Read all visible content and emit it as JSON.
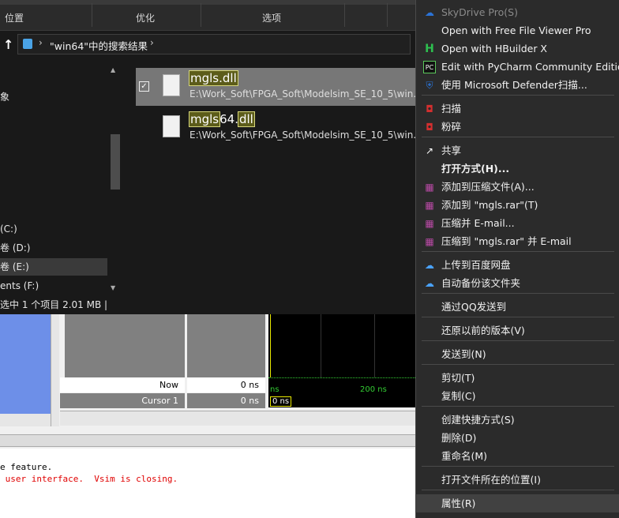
{
  "explorer": {
    "ribbon": {
      "group1": "位置",
      "group2": "优化",
      "group3": "选项"
    },
    "address": {
      "path": "\"win64\"中的搜索结果",
      "chevron": "›"
    },
    "nav": [
      {
        "label": "象"
      },
      {
        "label": "(C:)"
      },
      {
        "label": "卷 (D:)"
      },
      {
        "label": "卷 (E:)"
      },
      {
        "label": "ents (F:)"
      }
    ],
    "results": [
      {
        "name_hl1": "mgls.dll",
        "name_rest": "",
        "name_hl2": "",
        "path": "E:\\Work_Soft\\FPGA_Soft\\Modelsim_SE_10_5\\win...",
        "selected": true
      },
      {
        "name_hl1": "mgls",
        "name_rest": "64.",
        "name_hl2": "dll",
        "path": "E:\\Work_Soft\\FPGA_Soft\\Modelsim_SE_10_5\\win...",
        "selected": false
      }
    ],
    "status": "选中 1 个项目  2.01 MB  |"
  },
  "modelsim": {
    "now_label": "Now",
    "now_value": "0 ns",
    "cursor_label": "Cursor 1",
    "cursor_value": "0 ns",
    "wave_tick1": "ns",
    "wave_tick2": "200 ns",
    "wave_cursor": "0 ns",
    "console_line1": "e feature.",
    "console_line2": " user interface.  Vsim is closing."
  },
  "menu": {
    "items": [
      {
        "label": "SkyDrive Pro(S)",
        "icon": "☁",
        "icon_color": "#2b73d6",
        "disabled": true
      },
      {
        "label": "Open with Free File Viewer Pro",
        "icon": "",
        "icon_color": ""
      },
      {
        "label": "Open with HBuilder X",
        "icon": "H",
        "icon_color": "#2dbf4f"
      },
      {
        "label": "Edit with PyCharm Community Edition",
        "icon": "PC",
        "icon_color": "#000000"
      },
      {
        "label": "使用 Microsoft Defender扫描...",
        "icon": "⛨",
        "icon_color": "#2b73d6"
      },
      {
        "label": "扫描",
        "icon": "◘",
        "icon_color": "#d32f2f"
      },
      {
        "label": "粉碎",
        "icon": "◘",
        "icon_color": "#d32f2f"
      },
      {
        "label": "共享",
        "icon": "↗",
        "icon_color": "#ffffff"
      },
      {
        "label": "打开方式(H)...",
        "icon": "",
        "icon_color": ""
      },
      {
        "label": "添加到压缩文件(A)...",
        "icon": "▦",
        "icon_color": "#b94aa5"
      },
      {
        "label": "添加到 \"mgls.rar\"(T)",
        "icon": "▦",
        "icon_color": "#b94aa5"
      },
      {
        "label": "压缩并 E-mail...",
        "icon": "▦",
        "icon_color": "#b94aa5"
      },
      {
        "label": "压缩到 \"mgls.rar\" 并 E-mail",
        "icon": "▦",
        "icon_color": "#b94aa5"
      },
      {
        "label": "上传到百度网盘",
        "icon": "☁",
        "icon_color": "#4aa3ff"
      },
      {
        "label": "自动备份该文件夹",
        "icon": "☁",
        "icon_color": "#4aa3ff"
      },
      {
        "label": "通过QQ发送到",
        "icon": "",
        "icon_color": ""
      },
      {
        "label": "还原以前的版本(V)",
        "icon": "",
        "icon_color": ""
      },
      {
        "label": "发送到(N)",
        "icon": "",
        "icon_color": ""
      },
      {
        "label": "剪切(T)",
        "icon": "",
        "icon_color": ""
      },
      {
        "label": "复制(C)",
        "icon": "",
        "icon_color": ""
      },
      {
        "label": "创建快捷方式(S)",
        "icon": "",
        "icon_color": ""
      },
      {
        "label": "删除(D)",
        "icon": "",
        "icon_color": ""
      },
      {
        "label": "重命名(M)",
        "icon": "",
        "icon_color": ""
      },
      {
        "label": "打开文件所在的位置(I)",
        "icon": "",
        "icon_color": ""
      },
      {
        "label": "属性(R)",
        "icon": "",
        "icon_color": ""
      }
    ]
  }
}
